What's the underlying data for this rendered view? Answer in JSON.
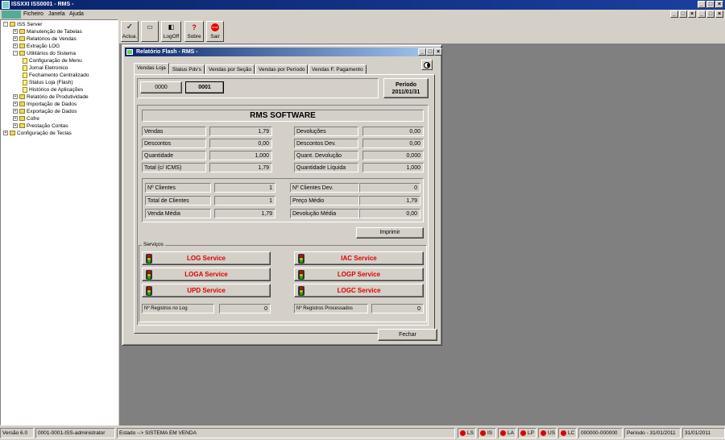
{
  "app": {
    "title": "ISSXXI ISS0001 - RMS -"
  },
  "menu": [
    "Ficheiro",
    "Janela",
    "Ajuda"
  ],
  "tree": [
    {
      "label": "ISS Server",
      "level": 0,
      "exp": "-",
      "icon": "server"
    },
    {
      "label": "Manutenção de Tabelas",
      "level": 1,
      "exp": "+",
      "icon": "folder"
    },
    {
      "label": "Relatórios de Vendas",
      "level": 1,
      "exp": "+",
      "icon": "folder"
    },
    {
      "label": "Extração LOG",
      "level": 1,
      "exp": "+",
      "icon": "folder"
    },
    {
      "label": "Utilitários do Sistema",
      "level": 1,
      "exp": "-",
      "icon": "folder"
    },
    {
      "label": "Configuração de Menu",
      "level": 2,
      "exp": "",
      "icon": "page"
    },
    {
      "label": "Jornal Eletronico",
      "level": 2,
      "exp": "",
      "icon": "page"
    },
    {
      "label": "Fechamento Centralizado",
      "level": 2,
      "exp": "",
      "icon": "page"
    },
    {
      "label": "Status Loja (Flash)",
      "level": 2,
      "exp": "",
      "icon": "page"
    },
    {
      "label": "Histórico de Aplicações",
      "level": 2,
      "exp": "",
      "icon": "page"
    },
    {
      "label": "Relatório de Produtividade",
      "level": 1,
      "exp": "+",
      "icon": "folder"
    },
    {
      "label": "Importação de Dados",
      "level": 1,
      "exp": "+",
      "icon": "folder"
    },
    {
      "label": "Exportação de Dados",
      "level": 1,
      "exp": "+",
      "icon": "folder"
    },
    {
      "label": "Cofre",
      "level": 1,
      "exp": "+",
      "icon": "folder"
    },
    {
      "label": "Prestação Contas",
      "level": 1,
      "exp": "+",
      "icon": "folder"
    },
    {
      "label": "Configuração de Teclas",
      "level": 0,
      "exp": "+",
      "icon": "folder"
    }
  ],
  "toolbar": [
    {
      "label": "Actua.",
      "icon": "✓"
    },
    {
      "label": "",
      "icon": "▭"
    },
    {
      "label": "LogOff",
      "icon": "◧"
    },
    {
      "label": "Sobre",
      "icon": "?"
    },
    {
      "label": "Sair",
      "icon": "STOP"
    }
  ],
  "dialog": {
    "title": "Relatório Flash - RMS -",
    "tabs": [
      "Vendas Loja",
      "Status Pdv's",
      "Vendas por Seção",
      "Vendas por Período",
      "Vendas F. Pagamento"
    ],
    "store_buttons": [
      "0000",
      "0001"
    ],
    "period_label": "Período",
    "period_value": "2011/01/31",
    "company": "RMS SOFTWARE",
    "left_fields": [
      [
        "Vendas",
        "1,79"
      ],
      [
        "Descontos",
        "0,00"
      ],
      [
        "Quantidade",
        "1,000"
      ],
      [
        "Total (c/ ICMS)",
        "1,79"
      ]
    ],
    "right_fields": [
      [
        "Devoluções",
        "0,00"
      ],
      [
        "Descontos Dev.",
        "0,00"
      ],
      [
        "Quant. Devolução",
        "0,000"
      ],
      [
        "Quantidade Líquida",
        "1,000"
      ]
    ],
    "left_clients": [
      [
        "Nº Clientes",
        "1"
      ],
      [
        "Total de Clientes",
        "1"
      ],
      [
        "Venda Média",
        "1,79"
      ]
    ],
    "right_clients": [
      [
        "Nº Clientes Dev.",
        "0"
      ],
      [
        "Preço Médio",
        "1,79"
      ],
      [
        "Devolução Média",
        "0,00"
      ]
    ],
    "print_label": "Imprimir",
    "services_label": "Serviços",
    "services_left": [
      "LOG Service",
      "LOGA Service",
      "UPD Service"
    ],
    "services_right": [
      "IAC Service",
      "LOGP Service",
      "LOGC Service"
    ],
    "reg_log_label": "Nº Registros no Log",
    "reg_log_value": "0",
    "reg_proc_label": "Nº Registros Processados",
    "reg_proc_value": "0",
    "close_label": "Fechar"
  },
  "status": {
    "version": "Versão 6.0",
    "user": "0001-0001-ISS-administrator",
    "state": "Estado --> SISTEMA EM VENDA",
    "indicators": [
      "LS",
      "IS",
      "LA",
      "LP",
      "US",
      "LC"
    ],
    "code": "000000-000000",
    "period": "Período - 31/01/2011",
    "date": "31/01/2011"
  }
}
